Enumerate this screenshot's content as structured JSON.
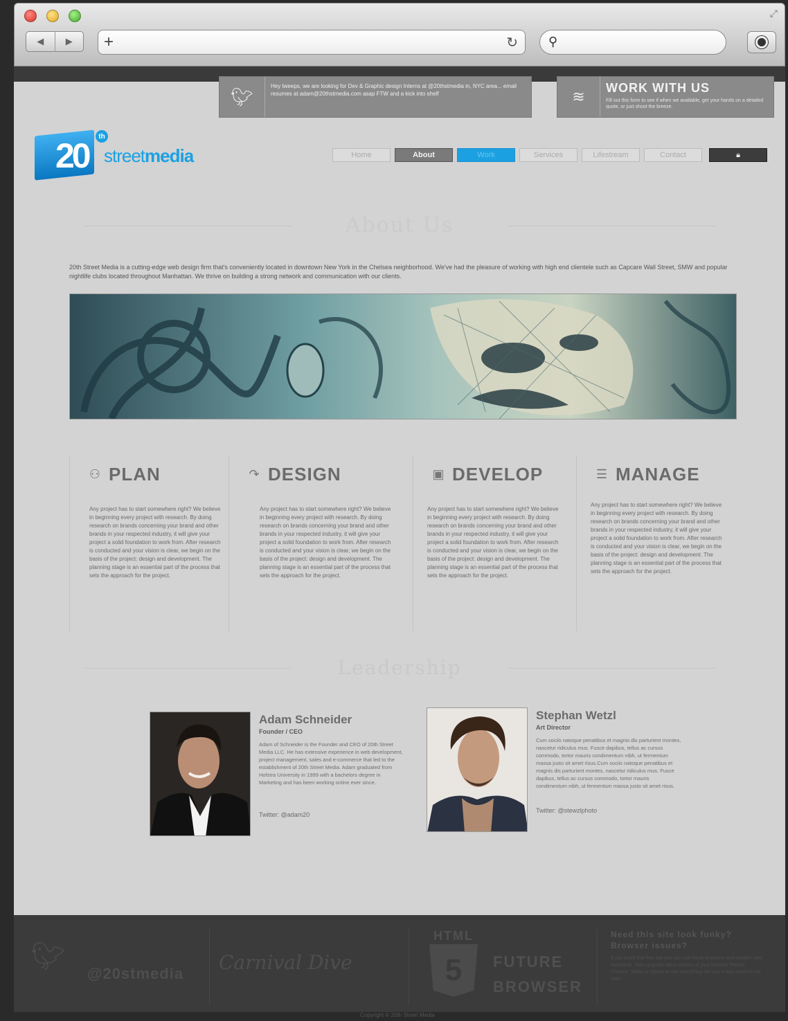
{
  "browser": {
    "back_icon": "arrow-left-icon",
    "forward_icon": "arrow-right-icon",
    "url_value": "",
    "search_value": ""
  },
  "tweet": {
    "text": "Hey tweeps, we are looking for Dev & Graphic design Interns at @20thstmedia in, NYC area... email resumes at adam@20thstmedia.com asap FTW and a kick into shelf"
  },
  "work_with_us": {
    "title": "WORK WITH US",
    "desc": "Fill out this form to see if when we available, get your hands on a detailed quote, or just shoot the breeze."
  },
  "logo": {
    "number": "20",
    "ordinal": "th",
    "word_light": "street",
    "word_bold": "media"
  },
  "nav": {
    "items": [
      "Home",
      "About",
      "Work",
      "Services",
      "Lifestream",
      "Contact"
    ],
    "lock_icon": "lock-icon"
  },
  "about": {
    "title": "About Us",
    "intro": "20th Street Media is a cutting-edge web design firm that's conveniently located in downtown New York in the Chelsea neighborhood. We've had the pleasure of working with high end clientele such as Capcare Wall Street, SMW and popular nightlife clubs located throughout Manhattan. We thrive on building a strong network and communication with our clients."
  },
  "services": [
    {
      "title": "PLAN",
      "icon": "people-icon",
      "text": "Any project has to start somewhere right? We believe in beginning every project with research. By doing research on brands concerning your brand and other brands in your respected industry, it will give your project a solid foundation to work from. After research is conducted and your vision is clear, we begin on the basis of the project: design and development. The planning stage is an essential part of the process that sets the approach for the project."
    },
    {
      "title": "DESIGN",
      "icon": "curve-arrow-icon",
      "text": "Any project has to start somewhere right? We believe in beginning every project with research. By doing research on brands concerning your brand and other brands in your respected industry, it will give your project a solid foundation to work from. After research is conducted and your vision is clear, we begin on the basis of the project: design and development. The planning stage is an essential part of the process that sets the approach for the project."
    },
    {
      "title": "DEVELOP",
      "icon": "window-icon",
      "text": "Any project has to start somewhere right? We believe in beginning every project with research. By doing research on brands concerning your brand and other brands in your respected industry, it will give your project a solid foundation to work from. After research is conducted and your vision is clear, we begin on the basis of the project: design and development. The planning stage is an essential part of the process that sets the approach for the project."
    },
    {
      "title": "MANAGE",
      "icon": "list-icon",
      "text": "Any project has to start somewhere right? We believe in beginning every project with research. By doing research on brands concerning your brand and other brands in your respected industry, it will give your project a solid foundation to work from. After research is conducted and your vision is clear, we begin on the basis of the project: design and development. The planning stage is an essential part of the process that sets the approach for the project."
    }
  ],
  "leadership": {
    "title": "Leadership",
    "people": [
      {
        "name": "Adam Schneider",
        "role": "Founder / CEO",
        "bio": "Adam of Schneider is the Founder and CEO of 20th Street Media LLC. He has extensive experience in web development, project management, sales and e-commerce that led to the establishment of 20th Street Media. Adam graduated from Hofstra University in 1999 with a bachelors degree in Marketing and has been working online ever since.",
        "twitter": "Twitter: @adam20"
      },
      {
        "name": "Stephan Wetzl",
        "role": "Art Director",
        "bio": "Cum sociis natoque penatibus et magnis dis parturient montes, nascetur ridiculus mus. Fusce dapibus, tellus ac cursus commodo, tortor mauris condimentum nibh, ut fermentum massa justo sit amet risus.Cum sociis natoque penatibus et magnis dis parturient montes, nascetur ridiculus mus. Fusce dapibus, tellus ac cursus commodo, tortor mauris condimentum nibh, ut fermentum massa justo sit amet risus.",
        "twitter": "Twitter: @stewzlphoto"
      }
    ]
  },
  "footer": {
    "twitter_handle": "@20stmedia",
    "script_text": "Carnival Dive",
    "html5_label": "HTML",
    "html5_number": "5",
    "future_line1": "FUTURE",
    "future_line2": "BROWSER",
    "cta_title": "Need this site look funky? Browser issues?",
    "cta_text": "If you loved this free site you can use these browsers and modern web standards. Wen upgrade latest version of your browser Firefox, Chrome, Safari or Opera to see everything the way it was meant to be seen."
  },
  "copyright": "Copyright © 20th Street Media"
}
